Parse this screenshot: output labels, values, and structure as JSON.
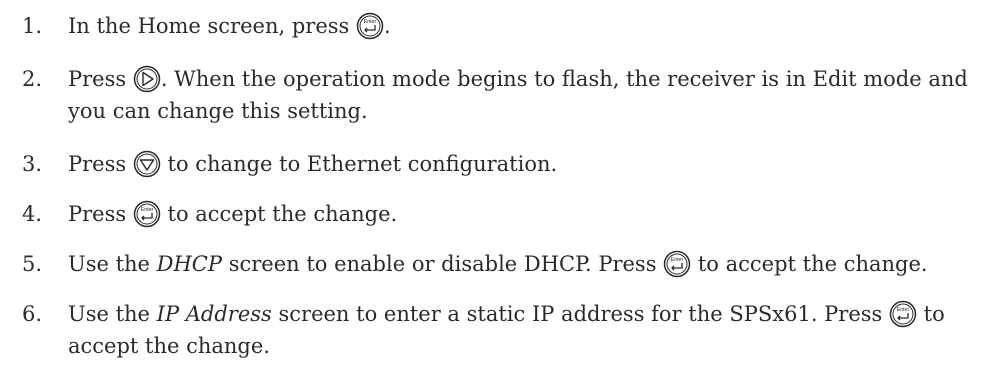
{
  "steps": [
    {
      "number": "1.",
      "parts": {
        "a": "In the Home screen, press ",
        "b": "."
      }
    },
    {
      "number": "2.",
      "parts": {
        "a": "Press ",
        "b": ". When the operation mode begins to flash, the receiver is in Edit mode and you can change this setting."
      }
    },
    {
      "number": "3.",
      "parts": {
        "a": "Press ",
        "b": " to change to Ethernet configuration."
      }
    },
    {
      "number": "4.",
      "parts": {
        "a": "Press ",
        "b": " to accept the change."
      }
    },
    {
      "number": "5.",
      "parts": {
        "a": "Use the ",
        "em": "DHCP",
        "b": " screen to enable or disable DHCP. Press ",
        "c": " to accept the change."
      }
    },
    {
      "number": "6.",
      "parts": {
        "a": "Use the ",
        "em": "IP Address",
        "b": " screen to enter a static IP address for the SPSx61. Press ",
        "c": " to accept the change."
      }
    }
  ],
  "icons": {
    "enter": {
      "name": "enter-key-icon",
      "label": "Enter"
    },
    "right": {
      "name": "right-arrow-key-icon"
    },
    "down": {
      "name": "down-arrow-key-icon"
    }
  }
}
